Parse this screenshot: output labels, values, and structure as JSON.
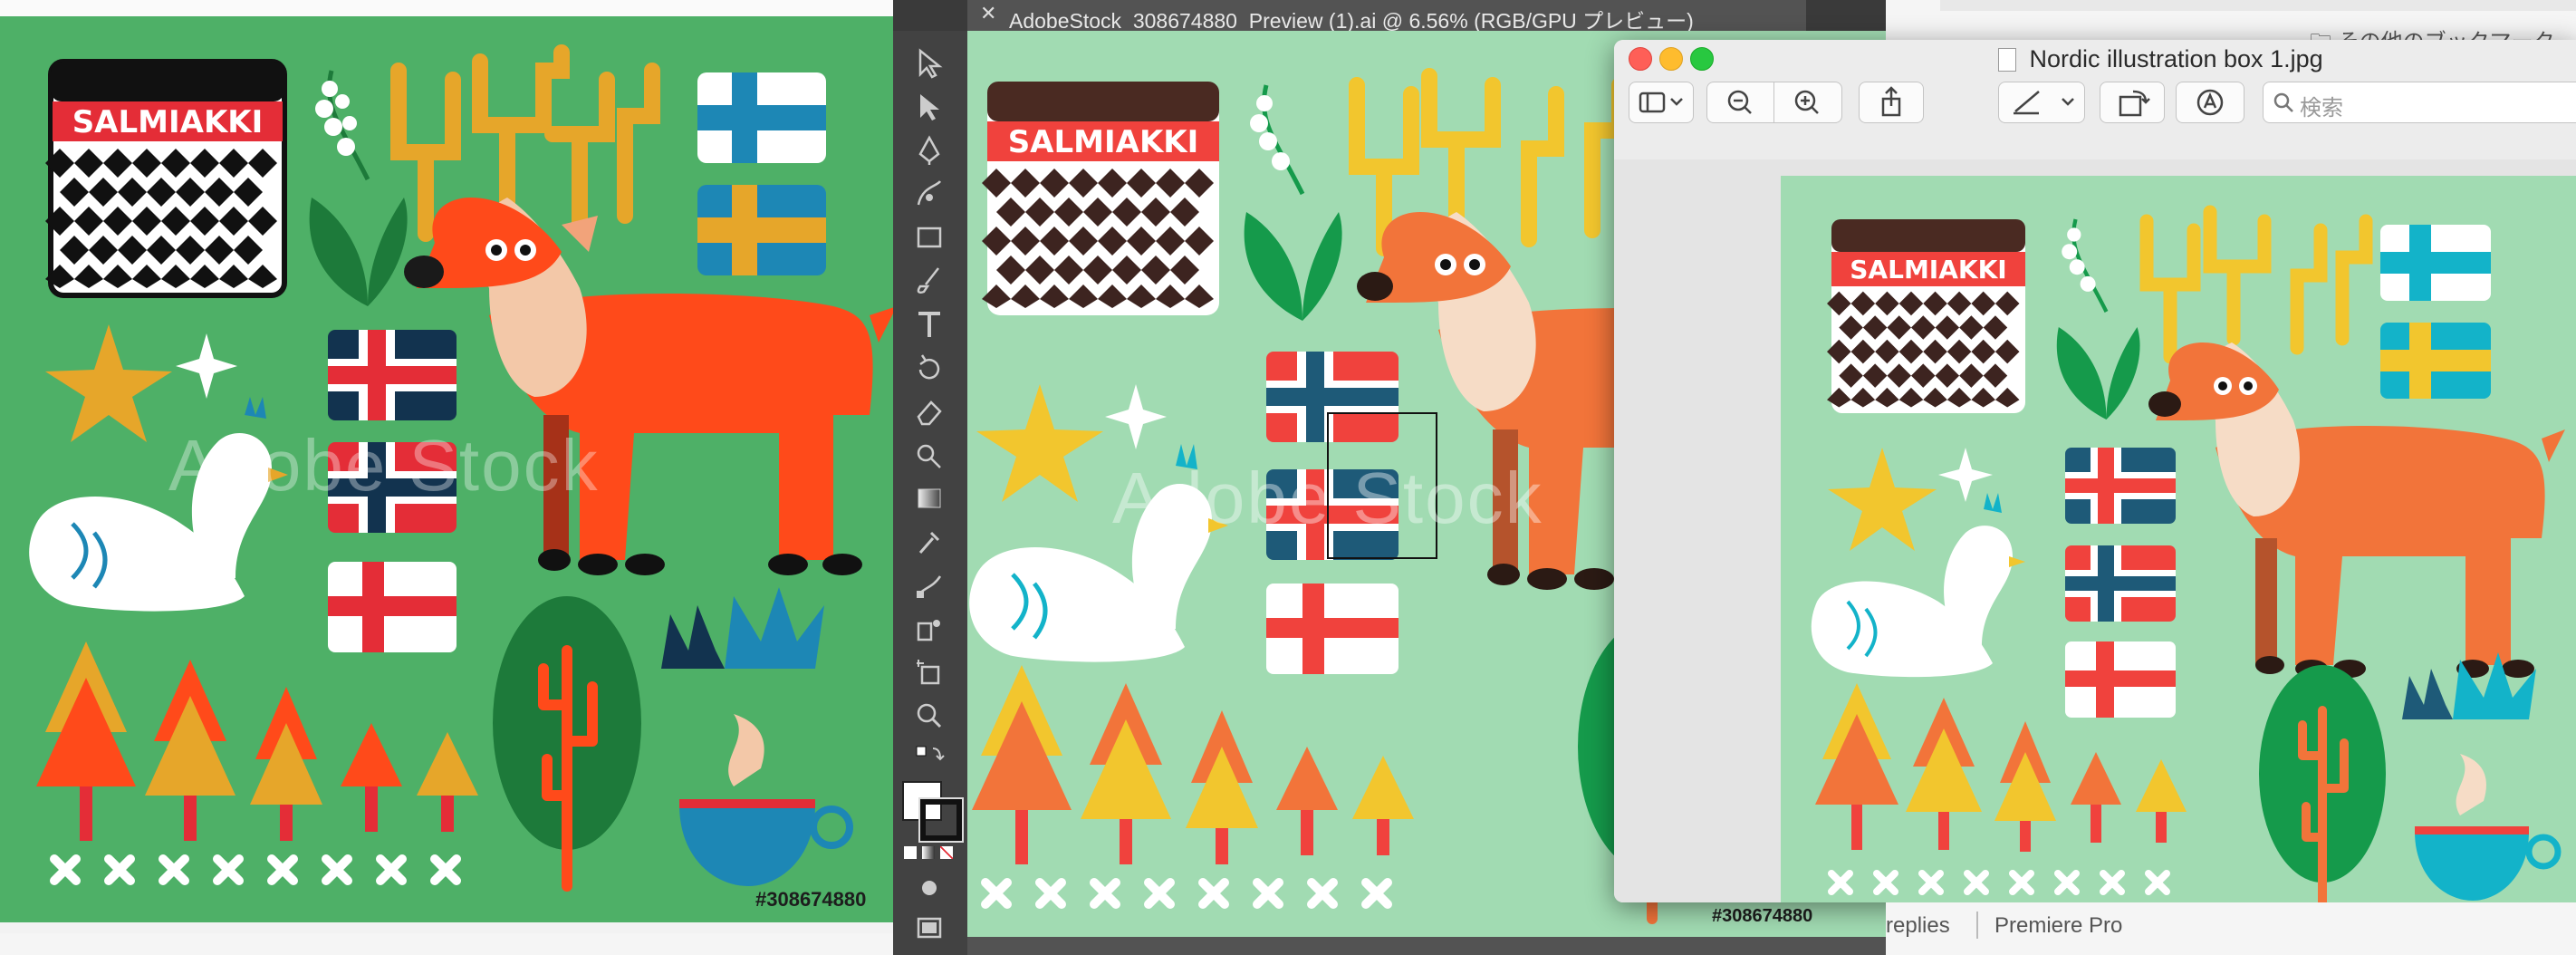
{
  "left_panel": {
    "stock_id": "#308674880",
    "salmiakki_label": "SALMIAKKI",
    "watermark": "Adobe Stock"
  },
  "illustrator": {
    "tab_title": "AdobeStock_308674880_Preview (1).ai @ 6.56% (RGB/GPU プレビュー)",
    "close_glyph": "✕",
    "stock_id": "#308674880",
    "salmiakki_label": "SALMIAKKI",
    "watermark": "Adobe Stock"
  },
  "preview": {
    "title": "Nordic illustration box 1.jpg",
    "search_placeholder": "検索",
    "salmiakki_label": "SALMIAKKI"
  },
  "background_window": {
    "bookmarks_text": "その他のブックマーク",
    "footer_items": [
      "replies",
      "Premiere Pro"
    ]
  },
  "colors": {
    "left_bg": "#4eb067",
    "art_bg_light": "#a1dbb2",
    "deer_red": "#ff4a1a",
    "deer_orange": "#f2743a",
    "yellow": "#f2c62e",
    "dark_green": "#1d7a3a",
    "navy": "#12334f",
    "red": "#e42d37"
  }
}
